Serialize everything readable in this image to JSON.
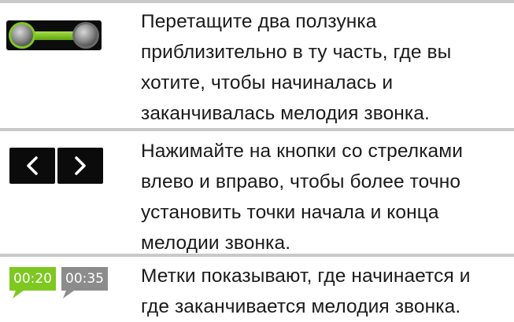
{
  "rows": [
    {
      "icon": "range-slider-icon",
      "text": "Перетащите два ползунка\nприблизительно в ту часть, где вы\nхотите, чтобы начиналась и\nзаканчивалась мелодия звонка."
    },
    {
      "icon": "arrow-buttons-icon",
      "text": "Нажимайте на кнопки со стрелками\nвлево и вправо, чтобы более точно\nустановить точки начала и конца\nмелодии звонка."
    },
    {
      "icon": "time-markers-icon",
      "text": "Метки показывают, где начинается и\nгде заканчивается мелодия звонка.",
      "start_marker": "00:20",
      "end_marker": "00:35"
    }
  ],
  "colors": {
    "accent_green": "#7ec820",
    "marker_gray": "#8c8c8c",
    "divider": "#c9c9c9"
  }
}
